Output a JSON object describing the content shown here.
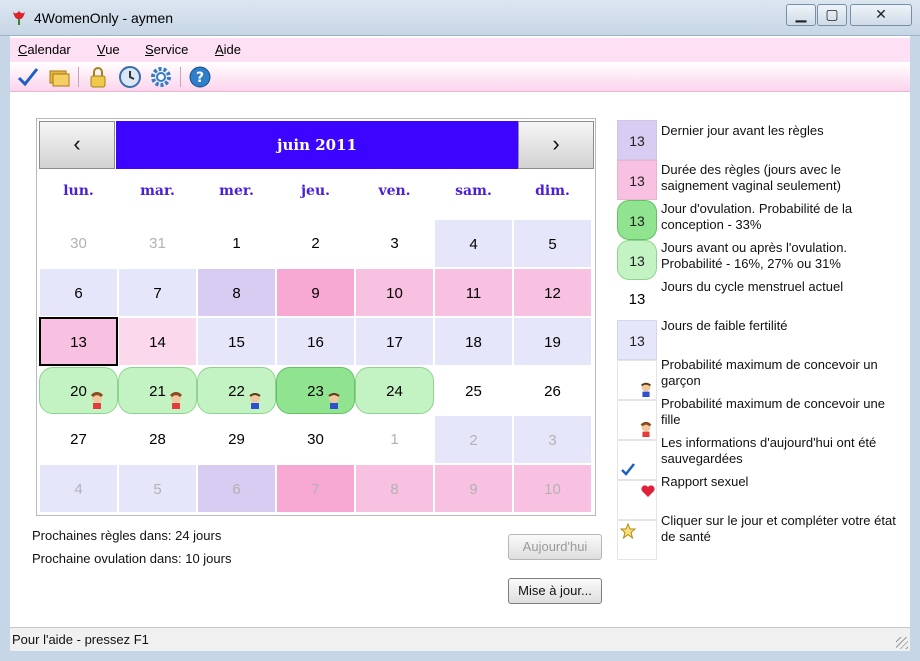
{
  "window": {
    "title": "4WomenOnly - aymen"
  },
  "menu": {
    "items": [
      "Calendar",
      "Vue",
      "Service",
      "Aide"
    ]
  },
  "toolbar": {
    "icons": [
      "check-icon",
      "folders-icon",
      "lock-icon",
      "clock-icon",
      "gear-icon",
      "help-icon"
    ]
  },
  "calendar": {
    "month": "juin 2011",
    "prev": "‹",
    "next": "›",
    "weekdays": [
      "lun.",
      "mar.",
      "mer.",
      "jeu.",
      "ven.",
      "sam.",
      "dim."
    ],
    "weeks": [
      [
        "30",
        "31",
        "1",
        "2",
        "3",
        "4",
        "5"
      ],
      [
        "6",
        "7",
        "8",
        "9",
        "10",
        "11",
        "12"
      ],
      [
        "13",
        "14",
        "15",
        "16",
        "17",
        "18",
        "19"
      ],
      [
        "20",
        "21",
        "22",
        "23",
        "24",
        "25",
        "26"
      ],
      [
        "27",
        "28",
        "29",
        "30",
        "1",
        "2",
        "3"
      ],
      [
        "4",
        "5",
        "6",
        "7",
        "8",
        "9",
        "10"
      ]
    ]
  },
  "info": {
    "next_period": "Prochaines règles dans: 24 jours",
    "next_ovulation": "Prochaine ovulation dans: 10 jours"
  },
  "buttons": {
    "today": "Aujourd'hui",
    "update": "Mise à jour..."
  },
  "legend": [
    {
      "num": "13",
      "text": "Dernier jour avant les règles"
    },
    {
      "num": "13",
      "text": "Durée des règles (jours avec le saignement vaginal seulement)"
    },
    {
      "num": "13",
      "text": "Jour d'ovulation. Probabilité de la conception - 33%"
    },
    {
      "num": "13",
      "text": "Jours avant ou après l'ovulation. Probabilité - 16%, 27% ou 31%"
    },
    {
      "num": "13",
      "text": "Jours du cycle menstruel actuel"
    },
    {
      "num": "13",
      "text": "Jours de faible fertilité"
    },
    {
      "num": "",
      "text": "Probabilité maximum de concevoir un garçon"
    },
    {
      "num": "",
      "text": "Probabilité maximum de concevoir une fille"
    },
    {
      "num": "",
      "text": "Les informations d'aujourd'hui ont été sauvegardées"
    },
    {
      "num": "",
      "text": "Rapport sexuel"
    },
    {
      "num": "",
      "text": "Cliquer sur le jour et compléter votre état de santé"
    }
  ],
  "status": {
    "text": "Pour l'aide - pressez F1"
  },
  "colors": {
    "month_bar": "#3b05ff",
    "weekday": "#4a1fd6",
    "period": "#f7a8d3",
    "ovulation": "#90e490",
    "fertile": "#c3f2c3",
    "low_fertility": "#e6e6fa"
  }
}
